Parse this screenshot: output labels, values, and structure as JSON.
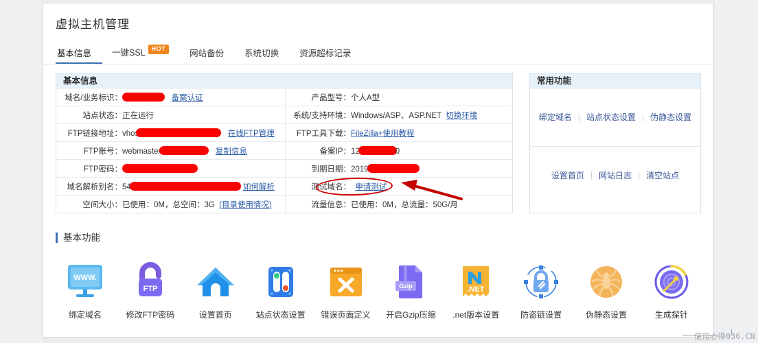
{
  "page": {
    "title": "虚拟主机管理",
    "watermark": "使用心得036.CN"
  },
  "tabs": [
    {
      "label": "基本信息",
      "active": true,
      "badge": null
    },
    {
      "label": "一键SSL",
      "active": false,
      "badge": "HOT"
    },
    {
      "label": "网站备份",
      "active": false,
      "badge": null
    },
    {
      "label": "系统切换",
      "active": false,
      "badge": null
    },
    {
      "label": "资源超标记录",
      "active": false,
      "badge": null
    }
  ],
  "info_panel": {
    "title": "基本信息",
    "rows": [
      {
        "left_label": "域名/业务标识：",
        "left_value": "",
        "left_redact": 62,
        "left_link": "备案认证",
        "right_label": "产品型号：",
        "right_value": "个人A型",
        "right_redact": 0,
        "right_link": ""
      },
      {
        "left_label": "站点状态：",
        "left_value": "正在运行",
        "left_redact": 0,
        "left_link": "",
        "right_label": "系统/支持环境：",
        "right_value": "Windows/ASP、ASP.NET",
        "right_redact": 0,
        "right_link": "切换环境"
      },
      {
        "left_label": "FTP链接地址：",
        "left_value": "vhos",
        "left_redact": 124,
        "left_link": "在线FTP管理",
        "right_label": "FTP工具下载：",
        "right_value": "",
        "right_redact": 0,
        "right_link": "FileZilla+使用教程"
      },
      {
        "left_label": "FTP账号：",
        "left_value": "webmaster",
        "left_redact": 72,
        "left_link": "复制信息",
        "right_label": "备案IP：",
        "right_value": "12",
        "right_redact": 56,
        "right_value_tail": "0",
        "right_link": ""
      },
      {
        "left_label": "FTP密码：",
        "left_value": "",
        "left_redact": 110,
        "left_link": "",
        "right_label": "到期日期：",
        "right_value": "2019",
        "right_redact": 76,
        "right_link": ""
      },
      {
        "left_label": "域名解析别名：",
        "left_value": "54",
        "left_redact": 162,
        "left_link": "如何解析",
        "right_label": "测试域名：",
        "right_value": "",
        "right_redact": 0,
        "right_link": "申请测试"
      },
      {
        "left_label": "空间大小：",
        "left_value": "已使用：0M，总空间：3G",
        "left_redact": 0,
        "left_link": "(目录使用情况)",
        "right_label": "流量信息：",
        "right_value": "已使用：0M，总流量：50G/月",
        "right_redact": 0,
        "right_link": ""
      }
    ]
  },
  "func_panel": {
    "title": "常用功能",
    "group1": [
      "绑定域名",
      "站点状态设置",
      "伪静态设置"
    ],
    "group2": [
      "设置首页",
      "网站日志",
      "清空站点"
    ]
  },
  "basic_functions": {
    "title": "基本功能",
    "items": [
      {
        "label": "绑定域名",
        "icon": "monitor-www-icon"
      },
      {
        "label": "修改FTP密码",
        "icon": "lock-ftp-icon"
      },
      {
        "label": "设置首页",
        "icon": "home-icon"
      },
      {
        "label": "站点状态设置",
        "icon": "toggle-switch-icon"
      },
      {
        "label": "错误页面定义",
        "icon": "browser-error-icon"
      },
      {
        "label": "开启Gzip压缩",
        "icon": "gzip-file-icon"
      },
      {
        "label": ".net版本设置",
        "icon": "dotnet-icon"
      },
      {
        "label": "防盗链设置",
        "icon": "lock-chain-icon"
      },
      {
        "label": "伪静态设置",
        "icon": "spider-icon"
      },
      {
        "label": "生成探针",
        "icon": "radar-probe-icon"
      }
    ]
  },
  "colors": {
    "accent": "#3c6fb4",
    "hot_badge": "#f08519",
    "panel_head": "#e7f1f9",
    "link": "#3b5998",
    "redaction": "#fa0202",
    "annotation": "#d00000"
  }
}
